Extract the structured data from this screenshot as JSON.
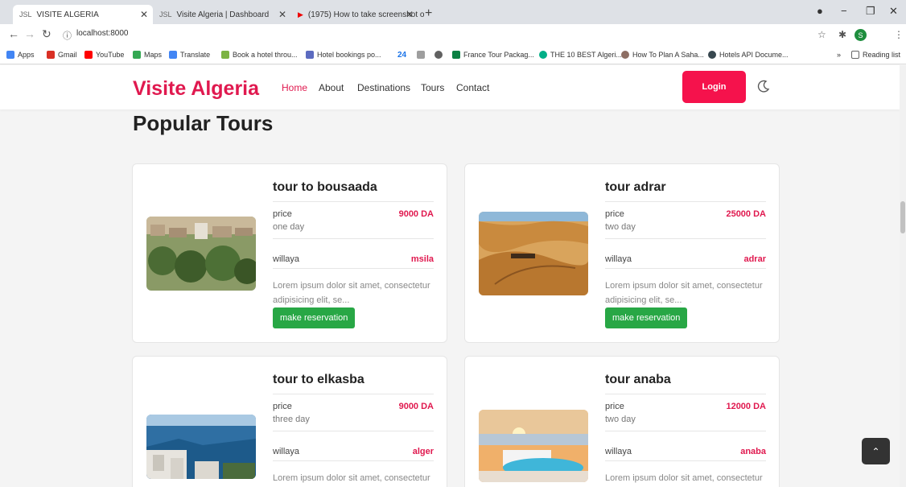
{
  "browser": {
    "tabs": [
      {
        "icon": "JSL",
        "title": "VISITE ALGERIA"
      },
      {
        "icon": "JSL",
        "title": "Visite Algeria | Dashboard"
      },
      {
        "icon": "▶",
        "title": "(1975) How to take screenshot o"
      }
    ],
    "url": "localhost:8000",
    "profile_initial": "S",
    "bookmarks": [
      {
        "label": "Apps",
        "color": "#4285f4"
      },
      {
        "label": "Gmail",
        "color": "#d93025"
      },
      {
        "label": "YouTube",
        "color": "#ff0000"
      },
      {
        "label": "Maps",
        "color": "#34a853"
      },
      {
        "label": "Translate",
        "color": "#4285f4"
      },
      {
        "label": "Book a hotel throu...",
        "color": "#7cb342"
      },
      {
        "label": "Hotel bookings po...",
        "color": "#5c6bc0"
      },
      {
        "label": "24",
        "color": "#1a73e8"
      },
      {
        "label": "",
        "color": "#9e9e9e"
      },
      {
        "label": "",
        "color": "#616161"
      },
      {
        "label": "France Tour Packag...",
        "color": "#0b8043"
      },
      {
        "label": "THE 10 BEST Algeri...",
        "color": "#00af87"
      },
      {
        "label": "How To Plan A Saha...",
        "color": "#8d6e63"
      },
      {
        "label": "Hotels API Docume...",
        "color": "#37474f"
      }
    ],
    "reading_list": "Reading list",
    "more_bookmarks": "»"
  },
  "site": {
    "brand": "Visite Algeria",
    "nav": [
      "Home",
      "About",
      "Destinations",
      "Tours",
      "Contact"
    ],
    "login_label": "Login",
    "section_title": "Popular Tours",
    "accent": "#e0194f"
  },
  "tours": [
    {
      "title": "tour to bousaada",
      "price_label": "price",
      "price": "9000 DA",
      "duration": "one day",
      "willaya_label": "willaya",
      "willaya": "msila",
      "desc": "Lorem ipsum dolor sit amet, consectetur adipisicing elit, se...",
      "button": "make reservation",
      "image": "town"
    },
    {
      "title": "tour adrar",
      "price_label": "price",
      "price": "25000 DA",
      "duration": "two day",
      "willaya_label": "willaya",
      "willaya": "adrar",
      "desc": "Lorem ipsum dolor sit amet, consectetur adipisicing elit, se...",
      "button": "make reservation",
      "image": "desert"
    },
    {
      "title": "tour to elkasba",
      "price_label": "price",
      "price": "9000 DA",
      "duration": "three day",
      "willaya_label": "willaya",
      "willaya": "alger",
      "desc": "Lorem ipsum dolor sit amet, consectetur",
      "button": "",
      "image": "coast"
    },
    {
      "title": "tour anaba",
      "price_label": "price",
      "price": "12000 DA",
      "duration": "two day",
      "willaya_label": "willaya",
      "willaya": "anaba",
      "desc": "Lorem ipsum dolor sit amet, consectetur",
      "button": "",
      "image": "pool"
    }
  ]
}
